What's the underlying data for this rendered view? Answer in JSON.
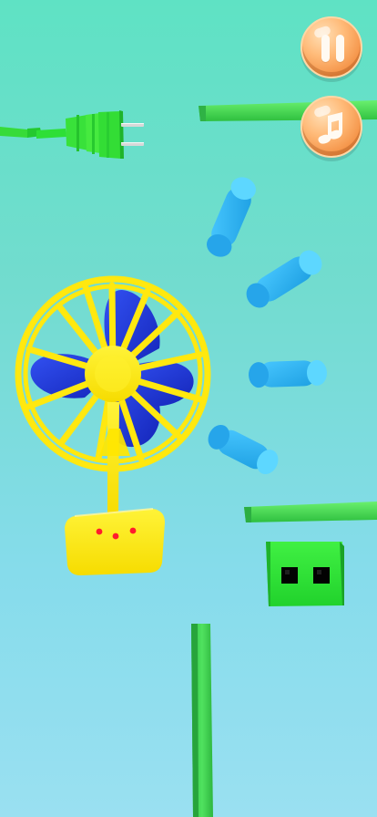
{
  "scene": {
    "background": "#72dccf",
    "accent_green": "#3be24c",
    "wall_green": "#38d84b",
    "fan_yellow": "#ffeb0f",
    "fan_blue": "#1d31d6",
    "wind_blue": "#34b6ef",
    "button_orange": "#f7a055"
  },
  "controls": {
    "pause_icon": "pause-icon",
    "music_icon": "music-note-icon"
  },
  "objects": {
    "plug": "green-plug",
    "fan": "yellow-fan",
    "player": "green-block-character"
  }
}
